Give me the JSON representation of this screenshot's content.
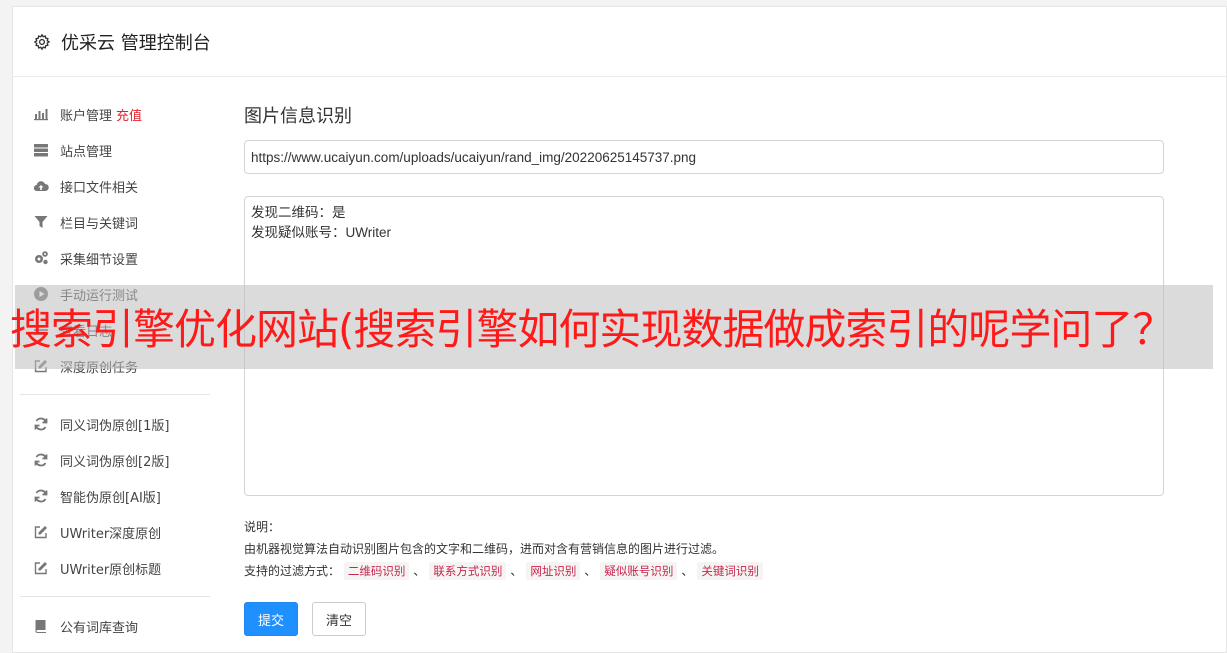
{
  "header": {
    "title": "优采云 管理控制台",
    "icon": "gear-icon"
  },
  "sidebar": {
    "groups": [
      [
        {
          "label": "账户管理",
          "extra": "充值",
          "icon": "bar-chart-icon"
        },
        {
          "label": "站点管理",
          "icon": "server-icon"
        },
        {
          "label": "接口文件相关",
          "icon": "cloud-upload-icon"
        },
        {
          "label": "栏目与关键词",
          "icon": "filter-icon"
        },
        {
          "label": "采集细节设置",
          "icon": "cogs-icon"
        },
        {
          "label": "手动运行测试",
          "icon": "play-circle-icon"
        },
        {
          "label": "查看日志",
          "icon": "list-icon"
        },
        {
          "label": "深度原创任务",
          "icon": "edit-icon"
        }
      ],
      [
        {
          "label": "同义词伪原创[1版]",
          "icon": "refresh-icon"
        },
        {
          "label": "同义词伪原创[2版]",
          "icon": "refresh-icon"
        },
        {
          "label": "智能伪原创[AI版]",
          "icon": "refresh-icon"
        },
        {
          "label": "UWriter深度原创",
          "icon": "edit-icon"
        },
        {
          "label": "UWriter原创标题",
          "icon": "edit-icon"
        }
      ],
      [
        {
          "label": "公有词库查询",
          "icon": "book-icon"
        }
      ]
    ]
  },
  "main": {
    "title": "图片信息识别",
    "url_value": "https://www.ucaiyun.com/uploads/ucaiyun/rand_img/20220625145737.png",
    "result_lines": [
      "发现二维码：是",
      "发现疑似账号：UWriter"
    ],
    "desc_label": "说明：",
    "desc_text": "由机器视觉算法自动识别图片包含的文字和二维码，进而对含有营销信息的图片进行过滤。",
    "filter_label": "支持的过滤方式：",
    "filter_tags": [
      "二维码识别",
      "联系方式识别",
      "网址识别",
      "疑似账号识别",
      "关键词识别"
    ],
    "separator": "、",
    "submit_label": "提交",
    "clear_label": "清空"
  },
  "overlay": {
    "text": "搜索引擎优化网站(搜索引擎如何实现数据做成索引的呢学问了？"
  },
  "colors": {
    "primary": "#1e90ff",
    "recharge": "#e0242d",
    "tag_text": "#c7254e",
    "overlay_text": "#ff1a1a"
  }
}
